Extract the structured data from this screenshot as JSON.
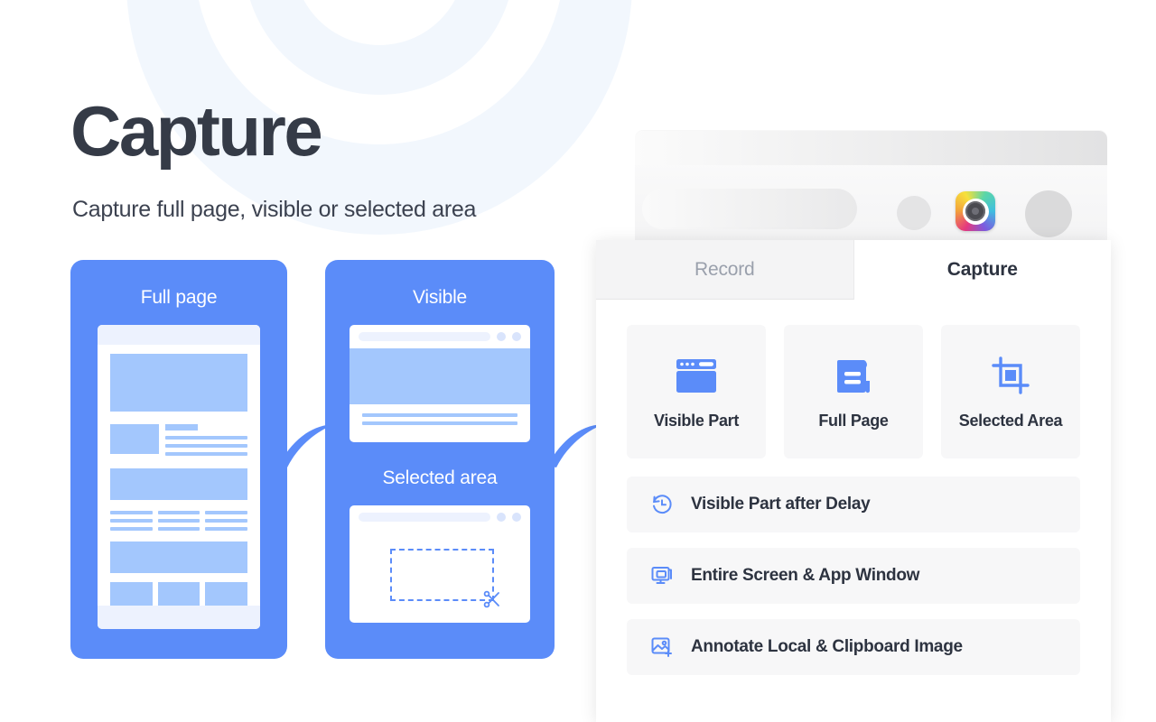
{
  "hero": {
    "title": "Capture",
    "subtitle": "Capture full page, visible or selected area"
  },
  "illustration": {
    "full_page_label": "Full page",
    "visible_label": "Visible",
    "selected_area_label": "Selected area"
  },
  "browser": {
    "extension_icon": "camera-lens-icon",
    "address_bar_placeholder": ""
  },
  "popup": {
    "tabs": [
      {
        "label": "Record",
        "active": false
      },
      {
        "label": "Capture",
        "active": true
      }
    ],
    "options": [
      {
        "label": "Visible Part",
        "icon": "browser-window-icon"
      },
      {
        "label": "Full Page",
        "icon": "scroll-document-icon"
      },
      {
        "label": "Selected Area",
        "icon": "crop-icon"
      }
    ],
    "rows": [
      {
        "label": "Visible Part after Delay",
        "icon": "clock-delay-icon"
      },
      {
        "label": "Entire Screen & App Window",
        "icon": "monitor-screen-icon"
      },
      {
        "label": "Annotate Local & Clipboard Image",
        "icon": "image-plus-icon"
      }
    ]
  },
  "colors": {
    "brand_blue": "#5B8CF9",
    "light_blue": "#A3C7FD",
    "pale_blue": "#EDF2FE",
    "heading_dark": "#353B47",
    "tile_bg": "#F7F7F8",
    "tab_inactive_text": "#9AA0AC"
  }
}
